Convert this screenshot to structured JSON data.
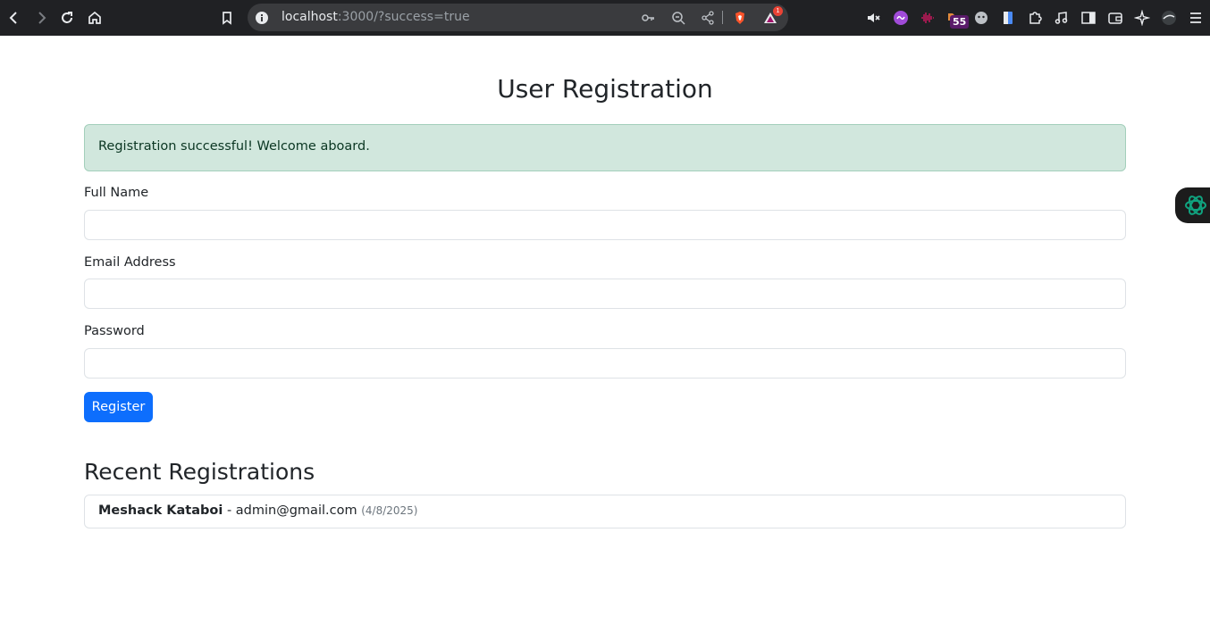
{
  "browser": {
    "url_host": "localhost",
    "url_rest": ":3000/?success=true",
    "extension_badge_count": "55",
    "shields_badge_count": "1",
    "icons": [
      "back-icon",
      "forward-icon",
      "reload-icon",
      "home-icon",
      "bookmark-icon",
      "site-info-icon",
      "key-icon",
      "zoom-icon",
      "share-icon",
      "brave-shields-icon",
      "rewards-icon",
      "mute-icon",
      "extensions-icon",
      "media-icon",
      "sidebar-icon",
      "wallet-icon",
      "leo-icon",
      "menu-icon"
    ]
  },
  "page": {
    "title": "User Registration",
    "alert_message": "Registration successful! Welcome aboard.",
    "form": {
      "full_name_label": "Full Name",
      "full_name_value": "",
      "email_label": "Email Address",
      "email_value": "",
      "password_label": "Password",
      "password_value": "",
      "submit_label": "Register"
    },
    "recent": {
      "title": "Recent Registrations",
      "items": [
        {
          "name": "Meshack Kataboi",
          "separator": " - ",
          "email": "admin@gmail.com",
          "date": "(4/8/2025)"
        }
      ]
    }
  },
  "colors": {
    "primary": "#0d6efd",
    "alert_bg": "#d1e7dd",
    "alert_text": "#0a3622",
    "toolbar_bg": "#202124"
  }
}
